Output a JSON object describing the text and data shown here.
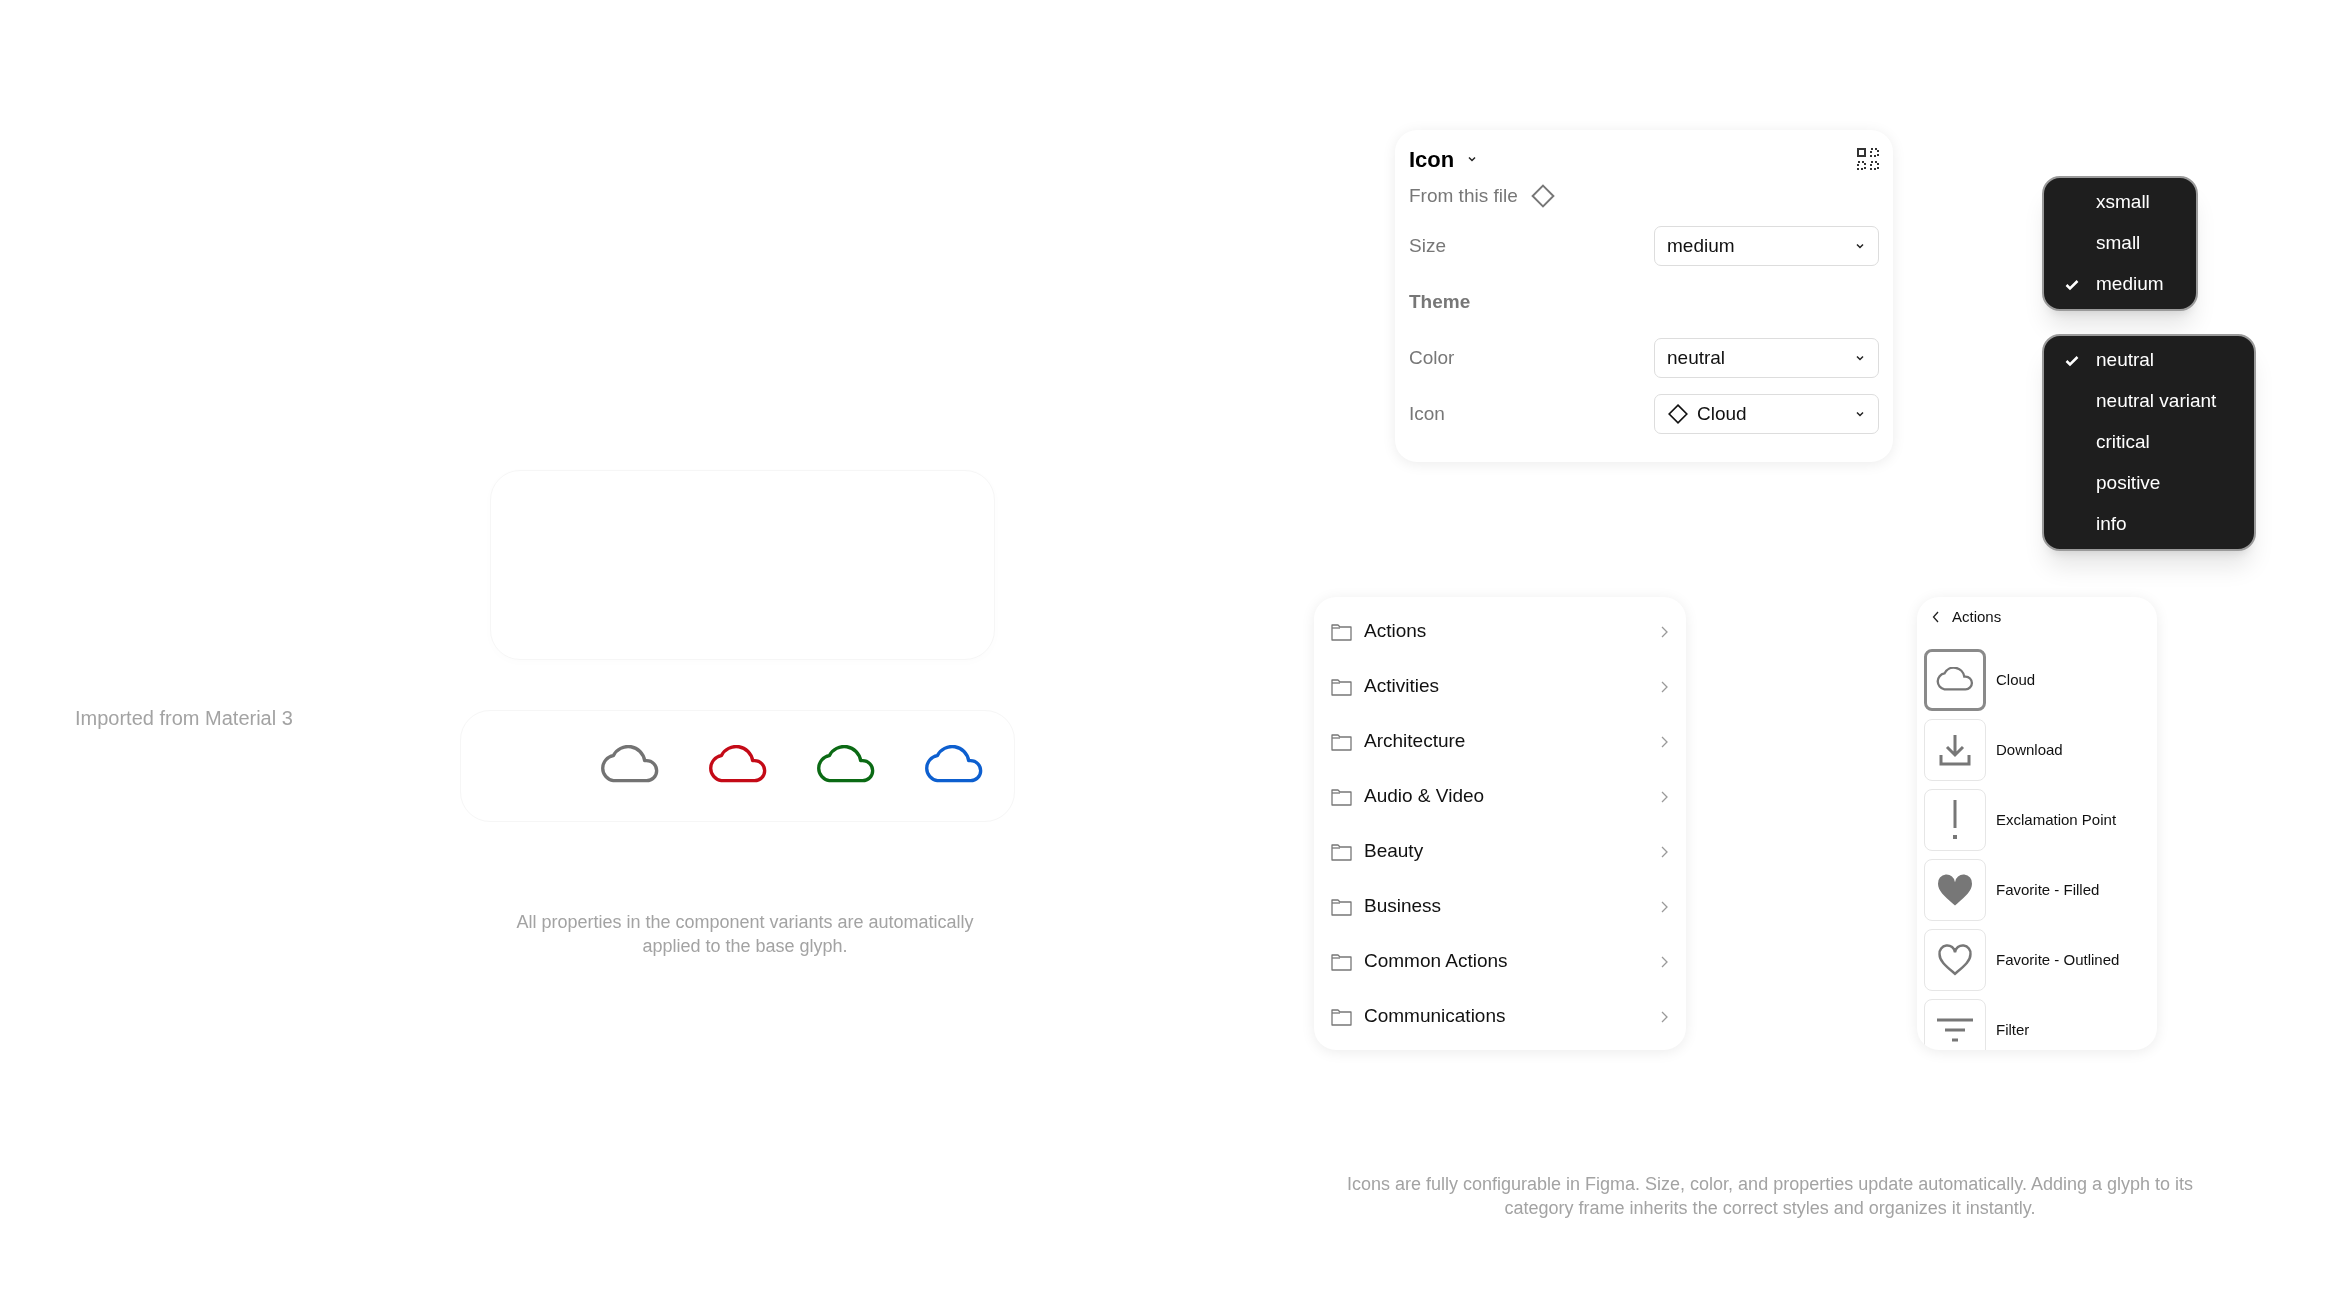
{
  "import_note": "Imported from Material 3",
  "cloud_variants": [
    {
      "color": "#737373"
    },
    {
      "color": "#c40a17"
    },
    {
      "color": "#0b6a14"
    },
    {
      "color": "#0d5fcf"
    }
  ],
  "caption": "All properties in the component variants are automatically applied to the base glyph.",
  "properties_panel": {
    "title": "Icon",
    "source": "From this file",
    "rows": [
      {
        "kind": "select",
        "label": "Size",
        "value": "medium"
      },
      {
        "kind": "heading",
        "label": "Theme"
      },
      {
        "kind": "select",
        "label": "Color",
        "value": "neutral"
      },
      {
        "kind": "instance",
        "label": "Icon",
        "value": "Cloud"
      }
    ]
  },
  "size_menu": [
    {
      "label": "xsmall",
      "selected": false
    },
    {
      "label": "small",
      "selected": false
    },
    {
      "label": "medium",
      "selected": true
    }
  ],
  "color_menu": [
    {
      "label": "neutral",
      "selected": true
    },
    {
      "label": "neutral variant",
      "selected": false
    },
    {
      "label": "critical",
      "selected": false
    },
    {
      "label": "positive",
      "selected": false
    },
    {
      "label": "info",
      "selected": false
    }
  ],
  "categories": [
    "Actions",
    "Activities",
    "Architecture",
    "Audio & Video",
    "Beauty",
    "Business",
    "Common Actions",
    "Communications"
  ],
  "icon_browser": {
    "back_label": "Actions",
    "items": [
      {
        "label": "Cloud",
        "selected": true
      },
      {
        "label": "Download",
        "selected": false
      },
      {
        "label": "Exclamation Point",
        "selected": false
      },
      {
        "label": "Favorite - Filled",
        "selected": false
      },
      {
        "label": "Favorite - Outlined",
        "selected": false
      },
      {
        "label": "Filter",
        "selected": false
      }
    ]
  },
  "footer_note": "Icons are fully configurable in Figma. Size, color, and properties update automatically. Adding a glyph to its category frame inherits the correct styles and organizes it instantly."
}
